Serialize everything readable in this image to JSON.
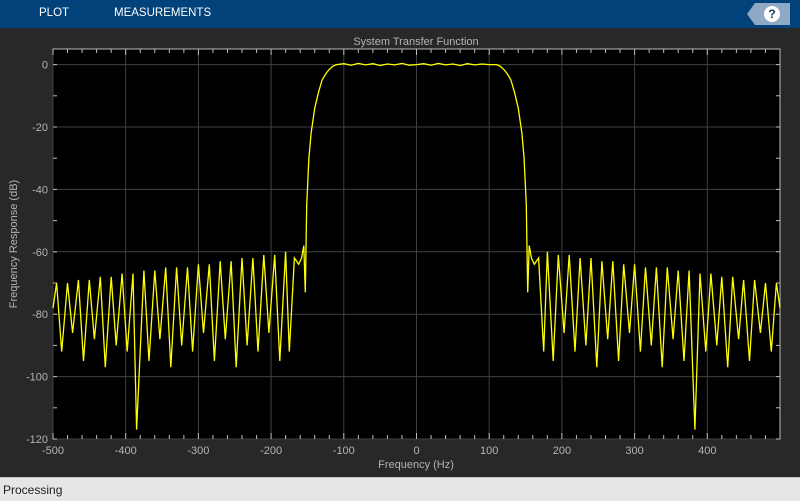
{
  "toolstrip": {
    "tabs": [
      "PLOT",
      "MEASUREMENTS"
    ],
    "help_label": "?"
  },
  "status": {
    "text": "Processing"
  },
  "colors": {
    "toolbar": "#02427a",
    "line": "#ffff00",
    "axes_bg": "#000000",
    "grid": "#404040"
  },
  "chart_data": {
    "type": "line",
    "title": "System Transfer Function",
    "xlabel": "Frequency (Hz)",
    "ylabel": "Frequency Response (dB)",
    "xlim": [
      -500,
      500
    ],
    "ylim": [
      -120,
      5
    ],
    "grid": true,
    "xticks": [
      -500,
      -400,
      -300,
      -200,
      -100,
      0,
      100,
      200,
      300,
      400
    ],
    "xtick_labels": [
      "-500",
      "-400",
      "-300",
      "-200",
      "-100",
      "0",
      "100",
      "200",
      "300",
      "400"
    ],
    "yticks": [
      0,
      -20,
      -40,
      -60,
      -80,
      -100,
      -120
    ],
    "ytick_labels": [
      "0",
      "-20",
      "-40",
      "-60",
      "-80",
      "-100",
      "-120"
    ],
    "series": [
      {
        "name": "Frequency Response",
        "x": [
          -500,
          -495,
          -488,
          -480,
          -473,
          -465,
          -458,
          -450,
          -443,
          -435,
          -428,
          -420,
          -413,
          -405,
          -398,
          -390,
          -385,
          -375,
          -368,
          -360,
          -353,
          -345,
          -338,
          -330,
          -323,
          -315,
          -308,
          -300,
          -293,
          -285,
          -278,
          -270,
          -263,
          -255,
          -248,
          -240,
          -233,
          -225,
          -218,
          -210,
          -203,
          -195,
          -188,
          -180,
          -175,
          -168,
          -162,
          -158,
          -155,
          -153,
          -151,
          -148,
          -145,
          -140,
          -135,
          -130,
          -125,
          -120,
          -115,
          -110,
          -100,
          -90,
          -80,
          -70,
          -60,
          -50,
          -40,
          -30,
          -20,
          -10,
          0,
          10,
          20,
          30,
          40,
          50,
          60,
          70,
          80,
          90,
          100,
          110,
          115,
          120,
          125,
          130,
          135,
          140,
          145,
          148,
          151,
          153,
          155,
          158,
          162,
          168,
          175,
          180,
          188,
          195,
          203,
          210,
          218,
          225,
          233,
          240,
          248,
          255,
          263,
          270,
          278,
          285,
          293,
          300,
          308,
          315,
          323,
          330,
          338,
          345,
          353,
          360,
          368,
          375,
          383,
          390,
          398,
          405,
          413,
          420,
          428,
          435,
          443,
          450,
          458,
          465,
          473,
          480,
          488,
          495,
          500
        ],
        "y": [
          -78,
          -70,
          -92,
          -70,
          -86,
          -69,
          -95,
          -69,
          -88,
          -68,
          -97,
          -68,
          -90,
          -67,
          -92,
          -67,
          -117,
          -66,
          -95,
          -66,
          -88,
          -65,
          -97,
          -65,
          -90,
          -65,
          -92,
          -64,
          -86,
          -64,
          -95,
          -63,
          -88,
          -63,
          -97,
          -62,
          -90,
          -62,
          -92,
          -61,
          -86,
          -61,
          -95,
          -60,
          -92,
          -62,
          -64,
          -62,
          -58,
          -73,
          -45,
          -30,
          -22,
          -14,
          -9,
          -5,
          -3,
          -1.5,
          -0.5,
          0,
          0.3,
          -0.2,
          0.4,
          -0.1,
          0.3,
          -0.3,
          0.2,
          -0.1,
          0.4,
          -0.2,
          0,
          0.3,
          -0.2,
          0.4,
          -0.1,
          0.2,
          -0.3,
          0.3,
          -0.1,
          0.2,
          0,
          0,
          -0.5,
          -1.5,
          -3,
          -5,
          -9,
          -14,
          -22,
          -30,
          -45,
          -73,
          -58,
          -62,
          -64,
          -62,
          -92,
          -60,
          -95,
          -61,
          -86,
          -61,
          -92,
          -62,
          -90,
          -62,
          -97,
          -63,
          -88,
          -63,
          -95,
          -64,
          -86,
          -64,
          -92,
          -65,
          -90,
          -65,
          -97,
          -65,
          -88,
          -66,
          -95,
          -66,
          -117,
          -67,
          -92,
          -67,
          -90,
          -68,
          -97,
          -68,
          -88,
          -69,
          -95,
          -69,
          -86,
          -70,
          -92,
          -70,
          -78
        ]
      }
    ]
  }
}
